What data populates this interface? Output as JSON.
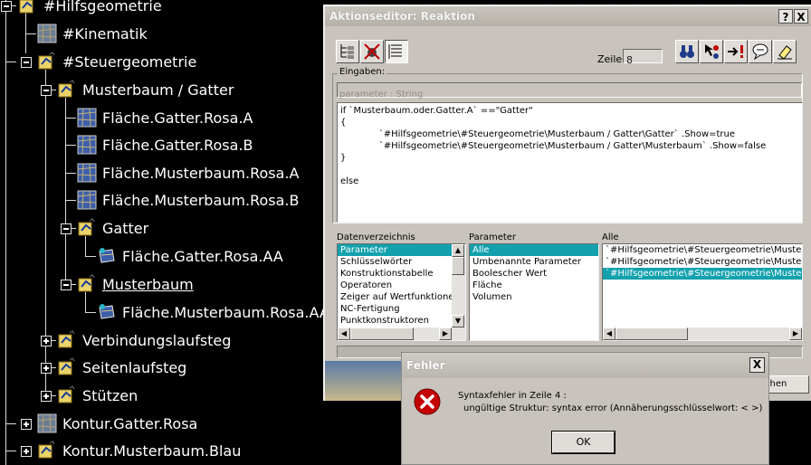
{
  "tree": {
    "items": [
      {
        "label": "#Hilfsgeometrie"
      },
      {
        "label": "#Kinematik"
      },
      {
        "label": "#Steuergeometrie"
      },
      {
        "label": "Musterbaum / Gatter"
      },
      {
        "label": "Fläche.Gatter.Rosa.A"
      },
      {
        "label": "Fläche.Gatter.Rosa.B"
      },
      {
        "label": "Fläche.Musterbaum.Rosa.A"
      },
      {
        "label": "Fläche.Musterbaum.Rosa.B"
      },
      {
        "label": "Gatter"
      },
      {
        "label": "Fläche.Gatter.Rosa.AA"
      },
      {
        "label": "Musterbaum"
      },
      {
        "label": "Fläche.Musterbaum.Rosa.AA"
      },
      {
        "label": "Verbindungslaufsteg"
      },
      {
        "label": "Seitenlaufsteg"
      },
      {
        "label": "Stützen"
      },
      {
        "label": "Kontur.Gatter.Rosa"
      },
      {
        "label": "Kontur.Musterbaum.Blau"
      }
    ]
  },
  "editor": {
    "title": "Aktionseditor: Reaktion",
    "help_btn": "?",
    "close_btn": "X",
    "line_label": "Zeile:",
    "line_value": "8",
    "inputs_label": "Eingaben:",
    "inputs_placeholder": "parameter : String",
    "code": [
      "if `Musterbaum.oder.Gatter.A` ==\"Gatter\"",
      "{",
      "    `#Hilfsgeometrie\\#Steuergeometrie\\Musterbaum / Gatter\\Gatter` .Show=true",
      "    `#Hilfsgeometrie\\#Steuergeometrie\\Musterbaum / Gatter\\Musterbaum` .Show=false",
      "}",
      "",
      "else"
    ],
    "col1_header": "Datenverzeichnis",
    "col2_header": "Parameter",
    "col3_header": "Alle",
    "col1_items": [
      "Parameter",
      "Schlüsselwörter",
      "Konstruktionstabelle",
      "Operatoren",
      "Zeiger auf Wertfunktione",
      "NC-Fertigung",
      "Punktkonstruktoren"
    ],
    "col2_items": [
      "Alle",
      "Umbenannte Parameter",
      "Boolescher Wert",
      "Fläche",
      "Volumen"
    ],
    "col3_items": [
      "`#Hilfsgeometrie\\#Steuergeometrie\\Musterb",
      "`#Hilfsgeometrie\\#Steuergeometrie\\Musterb",
      "`#Hilfsgeometrie\\#Steuergeometrie\\Musterb"
    ],
    "partial_button": "chen"
  },
  "error": {
    "title": "Fehler",
    "close_btn": "X",
    "line1": "Syntaxfehler in Zeile 4 :",
    "line2": "ungültige Struktur:  syntax error (Annäherungsschlüsselwort: < >)",
    "ok": "OK"
  },
  "colors": {
    "selection": "#12a1ad",
    "dialog_bg": "#c8c3bc",
    "tree_bg": "#000000",
    "error_icon": "#c40000"
  },
  "icons": [
    "hilfsgeometrie-icon",
    "kinematik-icon",
    "steuergeometrie-icon",
    "surface-icon",
    "surface-extract-icon",
    "error-icon"
  ]
}
